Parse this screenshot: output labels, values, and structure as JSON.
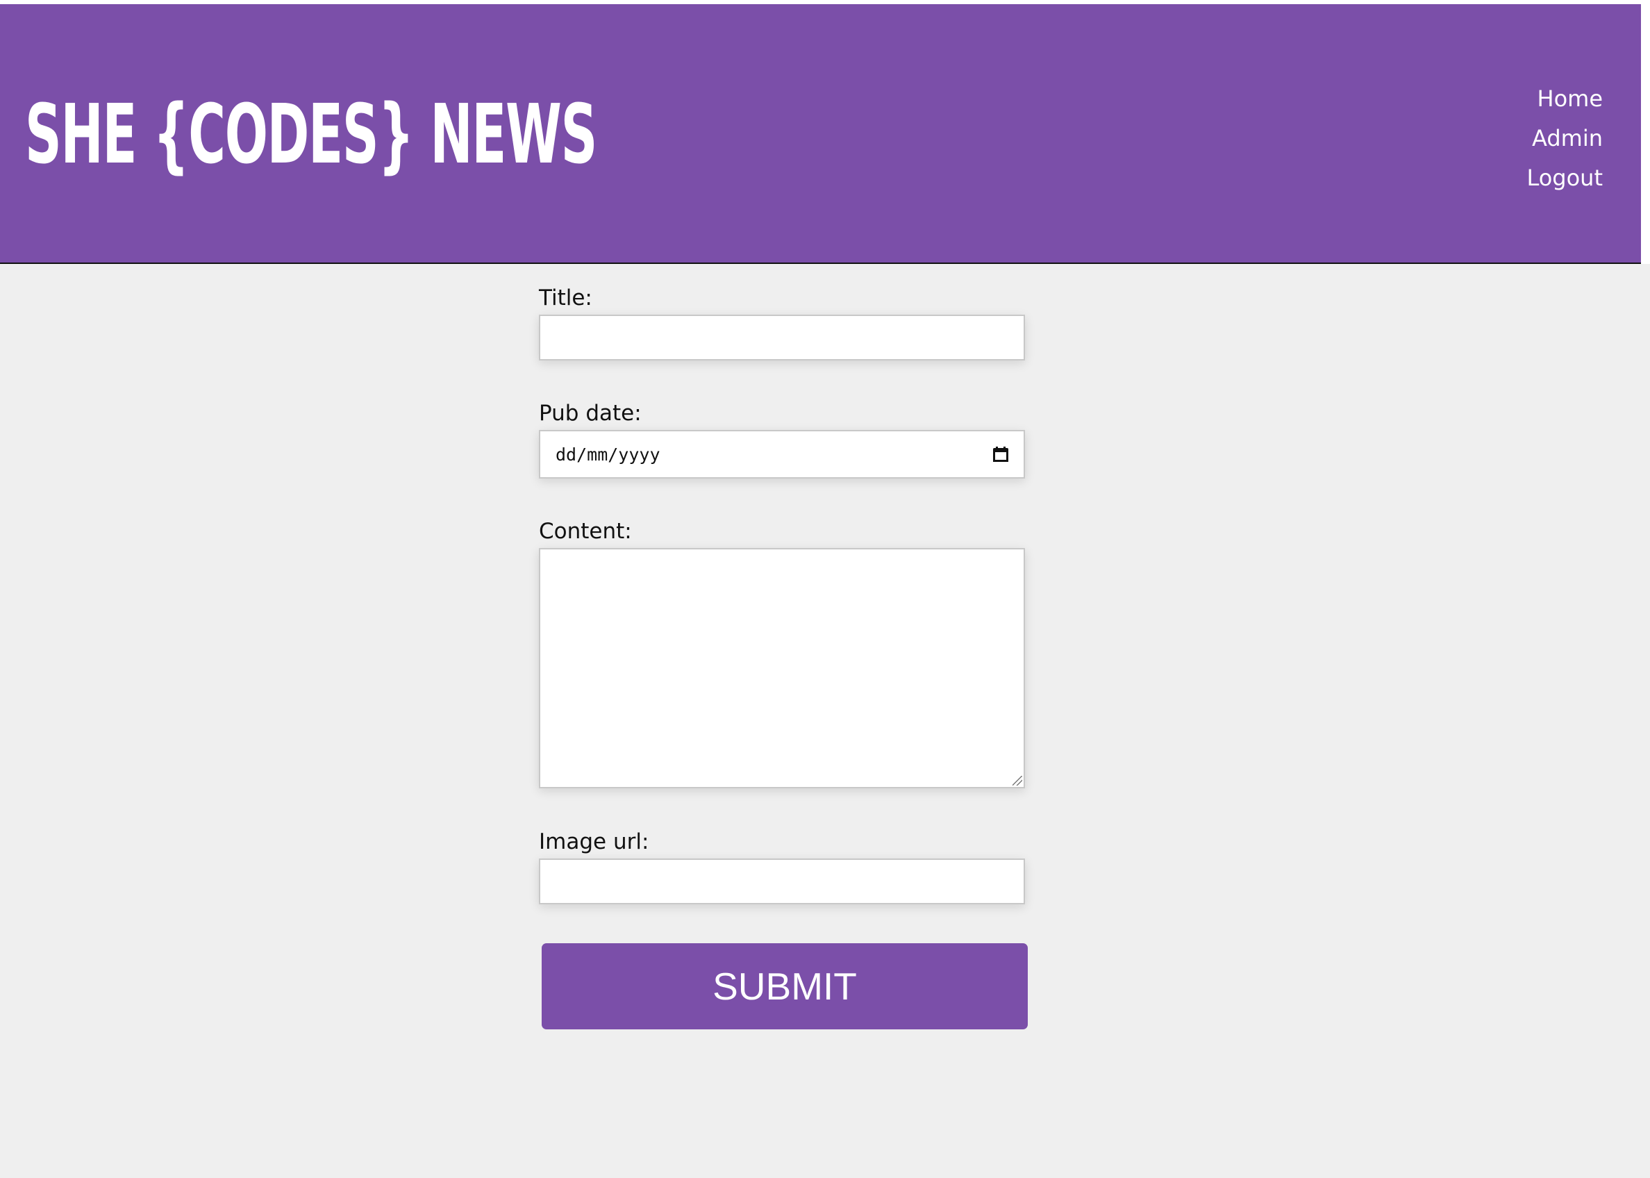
{
  "header": {
    "logo_text": "SHE {CODES} NEWS",
    "nav": [
      "Home",
      "Admin",
      "Logout"
    ]
  },
  "form": {
    "title_label": "Title:",
    "title_value": "",
    "pub_date_label": "Pub date:",
    "pub_date_placeholder": "dd/mm/yyyy",
    "content_label": "Content:",
    "content_value": "",
    "image_url_label": "Image url:",
    "image_url_value": "",
    "submit_label": "SUBMIT"
  },
  "colors": {
    "brand": "#7b4fa9",
    "background": "#efefef"
  }
}
